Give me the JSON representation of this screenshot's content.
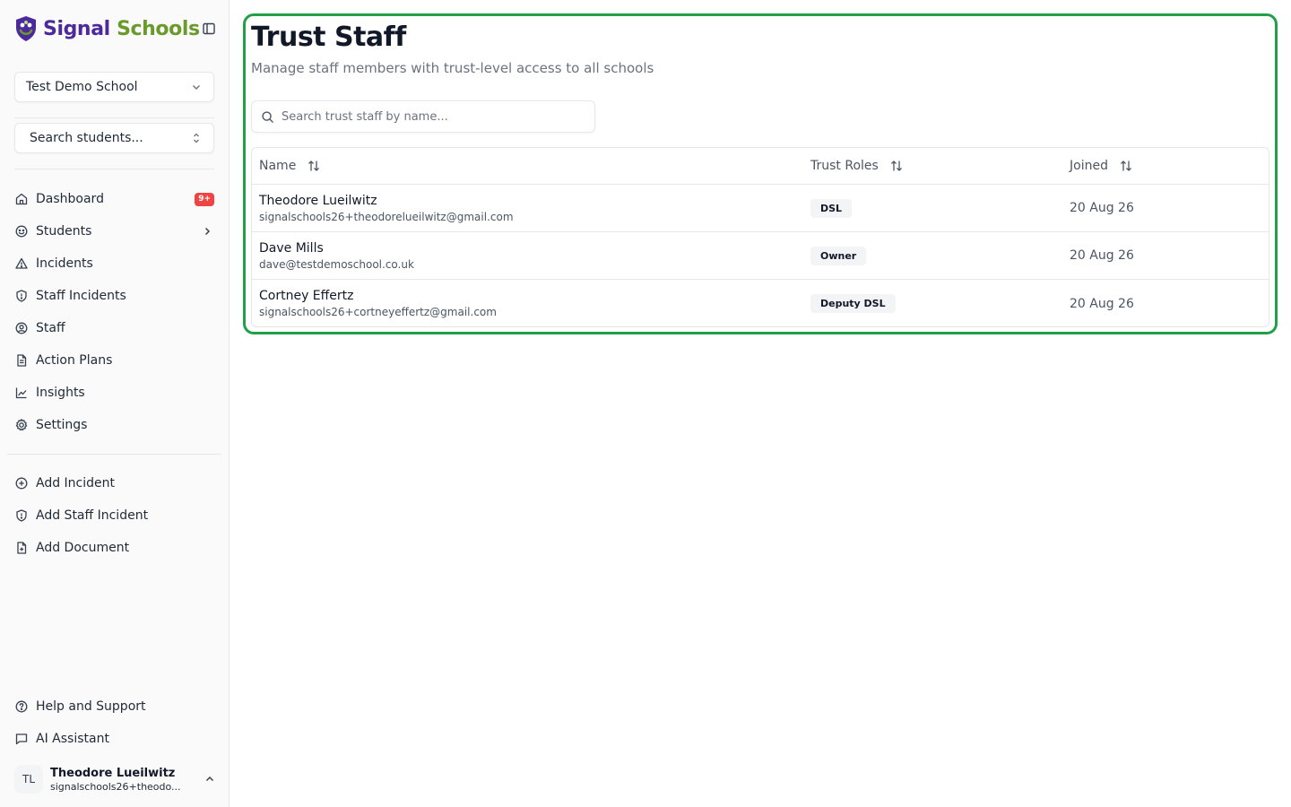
{
  "brand": {
    "name_part1": "Signal",
    "name_part2": "Schools",
    "color_primary": "#4c2a9c",
    "color_secondary": "#6a9a2c"
  },
  "sidebar": {
    "school_select": {
      "value": "Test Demo School"
    },
    "student_search": {
      "label": "Search students..."
    },
    "nav": [
      {
        "label": "Dashboard",
        "icon": "home-icon",
        "badge": "9+"
      },
      {
        "label": "Students",
        "icon": "smile-icon"
      },
      {
        "label": "Incidents",
        "icon": "alert-triangle-icon"
      },
      {
        "label": "Staff Incidents",
        "icon": "shield-alert-icon"
      },
      {
        "label": "Staff",
        "icon": "user-circle-icon"
      },
      {
        "label": "Action Plans",
        "icon": "file-text-icon"
      },
      {
        "label": "Insights",
        "icon": "line-chart-icon"
      },
      {
        "label": "Settings",
        "icon": "gear-icon"
      }
    ],
    "actions": [
      {
        "label": "Add Incident",
        "icon": "plus-circle-icon"
      },
      {
        "label": "Add Staff Incident",
        "icon": "shield-alert-icon"
      },
      {
        "label": "Add Document",
        "icon": "file-plus-icon"
      }
    ],
    "footer": [
      {
        "label": "Help and Support",
        "icon": "help-circle-icon"
      },
      {
        "label": "AI Assistant",
        "icon": "message-square-icon"
      }
    ],
    "user": {
      "initials": "TL",
      "name": "Theodore Lueilwitz",
      "email": "signalschools26+theodo..."
    }
  },
  "page": {
    "title": "Trust Staff",
    "subtitle": "Manage staff members with trust-level access to all schools",
    "search_placeholder": "Search trust staff by name...",
    "accent_border": "#22a047"
  },
  "table": {
    "columns": [
      "Name",
      "Trust Roles",
      "Joined"
    ],
    "rows": [
      {
        "name": "Theodore Lueilwitz",
        "email": "signalschools26+theodorelueilwitz@gmail.com",
        "role": "DSL",
        "joined": "20 Aug 26"
      },
      {
        "name": "Dave Mills",
        "email": "dave@testdemoschool.co.uk",
        "role": "Owner",
        "joined": "20 Aug 26"
      },
      {
        "name": "Cortney Effertz",
        "email": "signalschools26+cortneyeffertz@gmail.com",
        "role": "Deputy DSL",
        "joined": "20 Aug 26"
      }
    ]
  }
}
